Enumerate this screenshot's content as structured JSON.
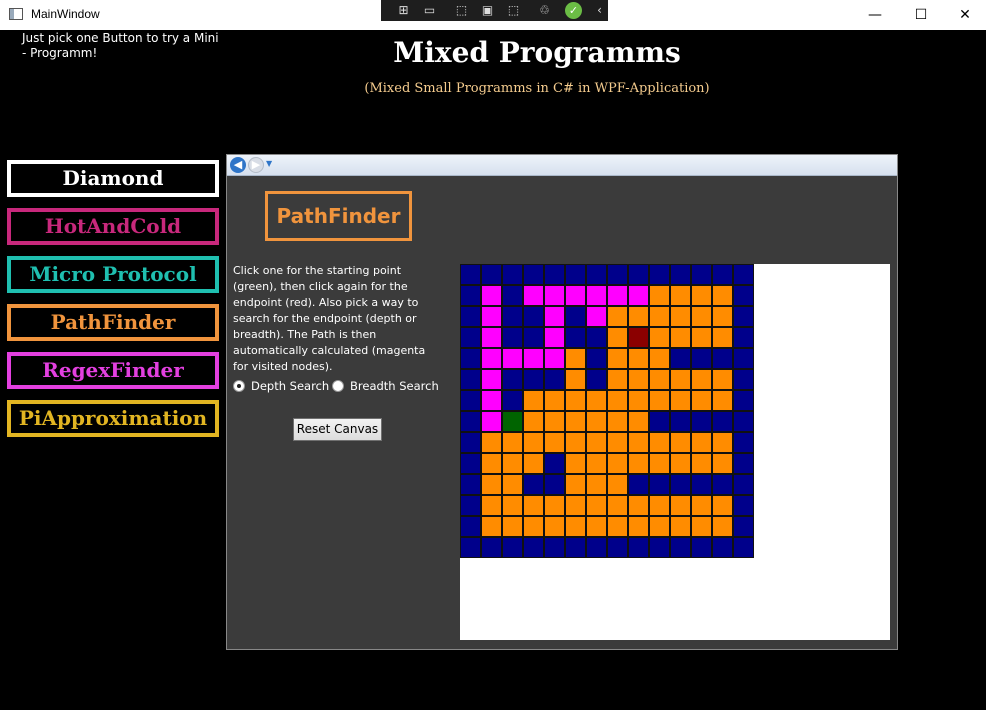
{
  "window": {
    "title": "MainWindow",
    "minimize_glyph": "—",
    "maximize_glyph": "☐",
    "close_glyph": "✕"
  },
  "debug_toolbar": {
    "icons": [
      "live-visual-tree-icon",
      "video-icon",
      "select-element-icon",
      "display-layout-icon",
      "track-focus-icon",
      "hot-reload-icon",
      "check-icon",
      "collapse-icon"
    ]
  },
  "header": {
    "hint": "Just pick one Button to try a Mini - Programm!",
    "title": "Mixed Programms",
    "subtitle": "(Mixed Small Programms in C# in WPF-Application)"
  },
  "nav": [
    {
      "label": "Diamond",
      "color": "#ffffff"
    },
    {
      "label": "HotAndCold",
      "color": "#c8287c"
    },
    {
      "label": "Micro Protocol",
      "color": "#1fbfb0"
    },
    {
      "label": "PathFinder",
      "color": "#f0943d"
    },
    {
      "label": "RegexFinder",
      "color": "#e340e0"
    },
    {
      "label": "PiApproximation",
      "color": "#e2b522"
    }
  ],
  "pathfinder": {
    "title": "PathFinder",
    "instructions": "Click one for the starting point (green), then click again for the endpoint (red). Also pick a way to search for the endpoint (depth or breadth). The Path is then automatically calculated (magenta for visited nodes).",
    "options": [
      {
        "label": "Depth Search",
        "checked": true
      },
      {
        "label": "Breadth Search",
        "checked": false
      }
    ],
    "reset_label": "Reset Canvas",
    "colors": {
      "B": "#00008b",
      "M": "#ff00ff",
      "O": "#ff8c00",
      "R": "#8b0000",
      "G": "#006400"
    },
    "grid": [
      "BBBBBBBBBBBBBB",
      "BMBMMMMMMOOOOB",
      "BMBBMBMOOOOOOB",
      "BMBBMBBOROOOOB",
      "BMMMMOBOOOBBBB",
      "BMBBBOBOOOOOOB",
      "BMBOOOOOOOOOOB",
      "BMGOOOOOOBBBBB",
      "BOOOOOOOOOOOOB",
      "BOOOBOOOOOOOOB",
      "BOOBBOOOBBBBBB",
      "BOOOOOOOOOOOOB",
      "BOOOOOOOOOOOOB",
      "BBBBBBBBBBBBBB"
    ]
  }
}
